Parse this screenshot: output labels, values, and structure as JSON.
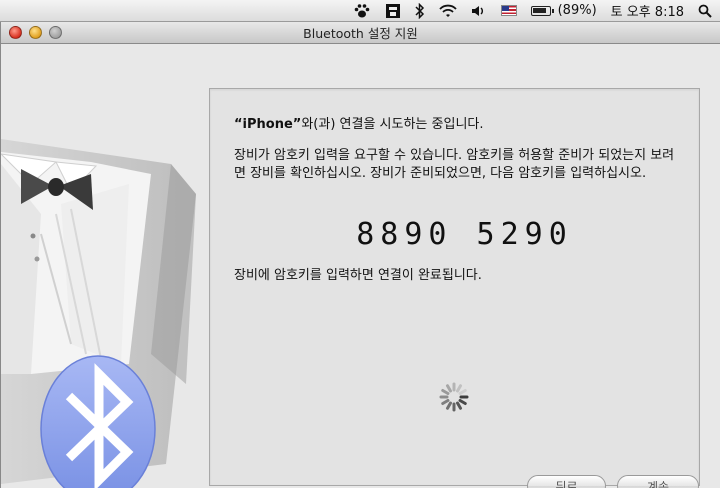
{
  "menubar": {
    "battery_percent": "(89%)",
    "battery_level": 0.89,
    "clock": "토 오후 8:18",
    "icons": [
      "paw-icon",
      "app-icon",
      "bluetooth-icon",
      "wifi-icon",
      "volume-icon",
      "us-flag-icon",
      "battery-icon",
      "spotlight-icon"
    ]
  },
  "window": {
    "title": "Bluetooth 설정 지원"
  },
  "pairing": {
    "device_name": "“iPhone”",
    "heading_suffix": "와(과) 연결을 시도하는 중입니다.",
    "instruction": "장비가 암호키 입력을 요구할 수 있습니다. 암호키를 허용할 준비가 되었는지 보려면 장비를 확인하십시오. 장비가 준비되었으면, 다음 암호키를 입력하십시오.",
    "passkey": "8890 5290",
    "completion": "장비에 암호키를 입력하면 연결이 완료됩니다."
  },
  "buttons": {
    "back": "뒤로",
    "continue": "계속"
  },
  "colors": {
    "bluetooth_blue": "#8aa2ee",
    "panel_bg": "#e3e3e3",
    "window_bg": "#e8e8e8"
  }
}
